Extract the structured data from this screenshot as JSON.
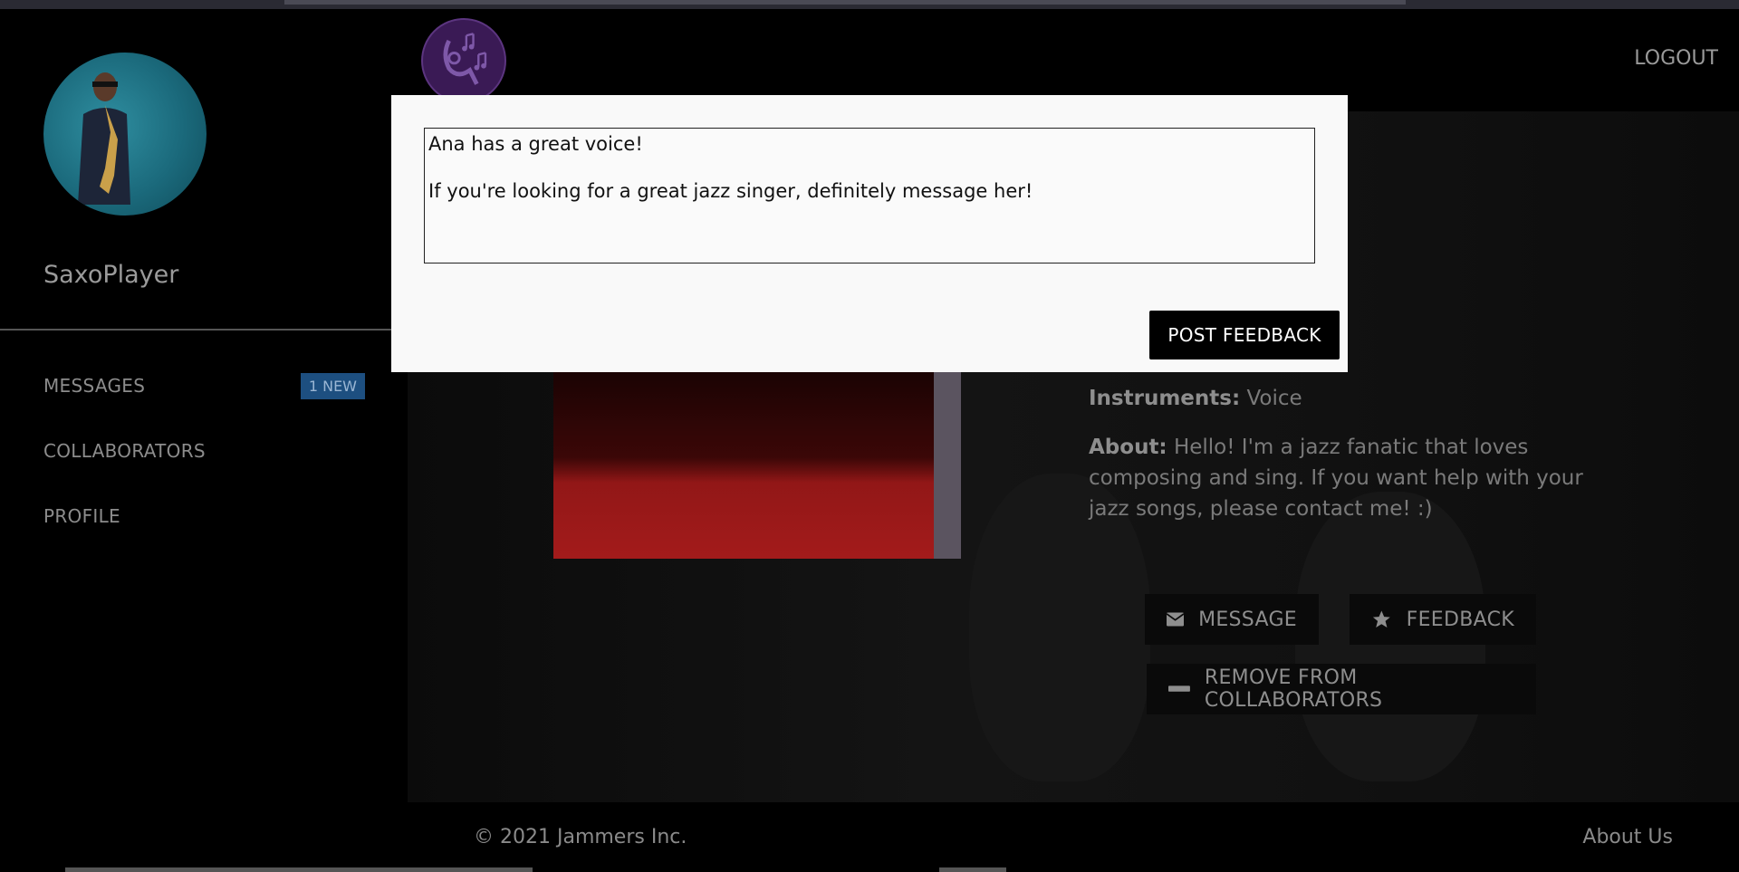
{
  "sidebar": {
    "username": "SaxoPlayer",
    "items": [
      {
        "label": "MESSAGES",
        "badge": "1 NEW"
      },
      {
        "label": "COLLABORATORS"
      },
      {
        "label": "PROFILE"
      }
    ]
  },
  "header": {
    "logout_label": "LOGOUT",
    "logo_icon": "music-note-hand-icon"
  },
  "profile": {
    "instruments_label": "Instruments:",
    "instruments_value": "Voice",
    "about_label": "About:",
    "about_value": "Hello! I'm a jazz fanatic that loves composing and sing. If you want help with your jazz songs, please contact me! :)",
    "message_label": "MESSAGE",
    "feedback_label": "FEEDBACK",
    "remove_label": "REMOVE FROM COLLABORATORS"
  },
  "modal": {
    "feedback_line1": "Ana has a great voice!",
    "feedback_line2": "If you're looking for a great jazz singer, definitely message her!",
    "post_label": "POST FEEDBACK"
  },
  "footer": {
    "copyright": "© 2021 Jammers Inc.",
    "about_link": "About Us"
  },
  "colors": {
    "badge_bg": "#1d4f80",
    "modal_bg": "#f9f9f9",
    "logo_bg": "#3a1a55"
  }
}
